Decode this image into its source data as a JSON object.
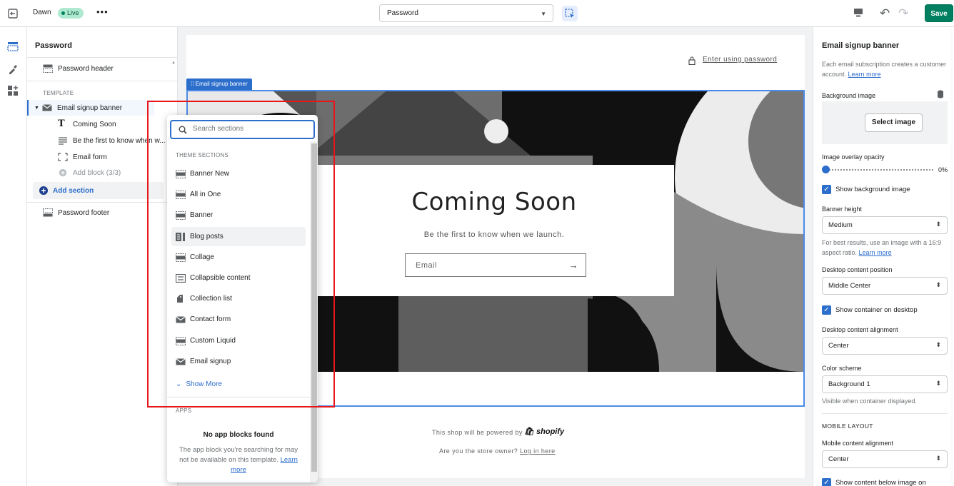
{
  "topbar": {
    "theme_name": "Dawn",
    "live_badge": "Live",
    "more": "•••",
    "page_select": "Password",
    "save_label": "Save"
  },
  "sidebar": {
    "title": "Password",
    "header_item": "Password header",
    "template_label": "TEMPLATE",
    "section": "Email signup banner",
    "blocks": [
      "Coming Soon",
      "Be the first to know when w...",
      "Email form",
      "Add block (3/3)"
    ],
    "add_section": "Add section",
    "footer_item": "Password footer"
  },
  "preview": {
    "enter_password": "Enter using password",
    "banner_tag": "Email signup banner",
    "heading": "Coming Soon",
    "subheading": "Be the first to know when we launch.",
    "email_placeholder": "Email",
    "powered_by": "This shop will be powered by",
    "shopify": "shopify",
    "owner_text": "Are you the store owner?",
    "login_link": "Log in here"
  },
  "popover": {
    "search_placeholder": "Search sections",
    "theme_sections_label": "THEME SECTIONS",
    "items": [
      "Banner New",
      "All in One",
      "Banner",
      "Blog posts",
      "Collage",
      "Collapsible content",
      "Collection list",
      "Contact form",
      "Custom Liquid",
      "Email signup"
    ],
    "show_more": "Show More",
    "apps_label": "APPS",
    "no_app_title": "No app blocks found",
    "no_app_text": "The app block you're searching for may not be available on this template.",
    "learn_more": "Learn more"
  },
  "settings": {
    "title": "Email signup banner",
    "desc": "Each email subscription creates a customer account.",
    "desc_link": "Learn more",
    "bg_image_label": "Background image",
    "select_image": "Select image",
    "overlay_label": "Image overlay opacity",
    "overlay_value": "0%",
    "overlay_fraction": 0,
    "show_bg_label": "Show background image",
    "banner_height_label": "Banner height",
    "banner_height_value": "Medium",
    "best_results": "For best results, use an image with a 16:9 aspect ratio.",
    "best_results_link": "Learn more",
    "desktop_pos_label": "Desktop content position",
    "desktop_pos_value": "Middle Center",
    "show_container_label": "Show container on desktop",
    "desktop_align_label": "Desktop content alignment",
    "desktop_align_value": "Center",
    "color_scheme_label": "Color scheme",
    "color_scheme_value": "Background 1",
    "visible_when": "Visible when container displayed.",
    "mobile_layout": "MOBILE LAYOUT",
    "mobile_align_label": "Mobile content alignment",
    "mobile_align_value": "Center",
    "show_below_label": "Show content below image on"
  },
  "colors": {
    "accent": "#2c6ecb",
    "save": "#008060",
    "highlight": "#e8161a"
  }
}
